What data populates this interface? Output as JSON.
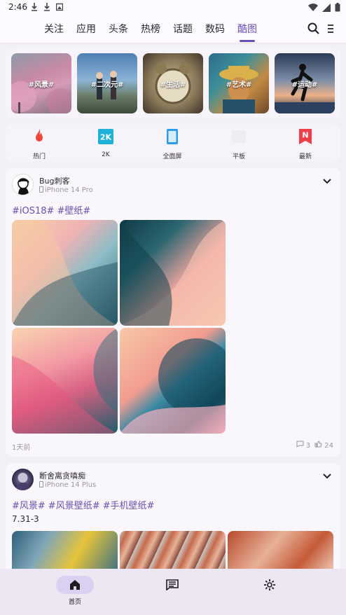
{
  "status_bar": {
    "time": "2:46"
  },
  "top_tabs": [
    {
      "label": "关注",
      "active": false
    },
    {
      "label": "应用",
      "active": false
    },
    {
      "label": "头条",
      "active": false
    },
    {
      "label": "热榜",
      "active": false
    },
    {
      "label": "话题",
      "active": false
    },
    {
      "label": "数码",
      "active": false
    },
    {
      "label": "酷图",
      "active": true
    }
  ],
  "top_actions": {
    "search": "search-icon",
    "menu": "menu-icon"
  },
  "categories": [
    {
      "label": "#风景#"
    },
    {
      "label": "#二次元#"
    },
    {
      "label": "#生活#"
    },
    {
      "label": "#艺术#"
    },
    {
      "label": "#运动#"
    }
  ],
  "quick_nav": [
    {
      "label": "热门",
      "icon": "flame-icon",
      "color": "#f0453a"
    },
    {
      "label": "2K",
      "icon": "2k-icon",
      "color": "#1fb2d8"
    },
    {
      "label": "全面屏",
      "icon": "phone-icon",
      "color": "#2e9be6"
    },
    {
      "label": "平板",
      "icon": "tablet-icon",
      "color": "#e9e9ef"
    },
    {
      "label": "最新",
      "icon": "new-badge-icon",
      "color": "#ef3e4a"
    }
  ],
  "posts": [
    {
      "user": "Bug刺客",
      "device": "iPhone 14 Pro",
      "tags": [
        "#iOS18#",
        "#壁纸#"
      ],
      "time": "1天前",
      "comments": "3",
      "likes": "24"
    },
    {
      "user": "断舍离贪嗔痴",
      "device": "iPhone 14 Plus",
      "tags": [
        "#风景#",
        "#风景壁纸#",
        "#手机壁纸#"
      ],
      "subtitle": "7.31-3"
    }
  ],
  "bottom_nav": [
    {
      "label": "首页",
      "icon": "home-icon",
      "active": true
    },
    {
      "label": "",
      "icon": "message-icon",
      "active": false
    },
    {
      "label": "",
      "icon": "settings-icon",
      "active": false
    }
  ],
  "colors": {
    "accent": "#6a4fb3",
    "background": "#f3eff6"
  }
}
